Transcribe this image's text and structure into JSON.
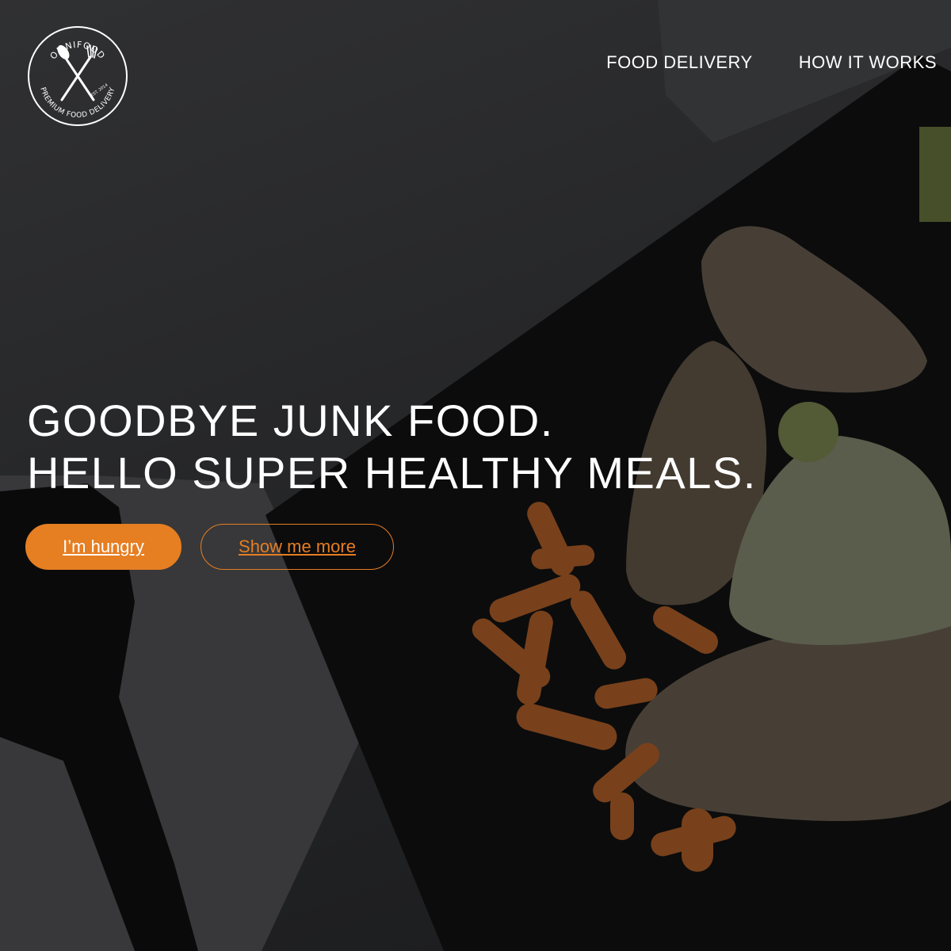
{
  "brand": {
    "name": "OMNIFOOD",
    "tagline": "PREMIUM FOOD DELIVERY",
    "est": "EST. 2014",
    "logo_icon": "crossed-spoon-fork-icon"
  },
  "nav": {
    "items": [
      {
        "label": "FOOD DELIVERY"
      },
      {
        "label": "HOW IT WORKS"
      }
    ]
  },
  "hero": {
    "headline_line1": "GOODBYE JUNK FOOD.",
    "headline_line2": "HELLO SUPER HEALTHY MEALS.",
    "primary_button": "I’m hungry",
    "secondary_button": "Show me more"
  },
  "colors": {
    "accent": "#e67e22",
    "text": "#ffffff",
    "background": "#2b2c2e"
  }
}
